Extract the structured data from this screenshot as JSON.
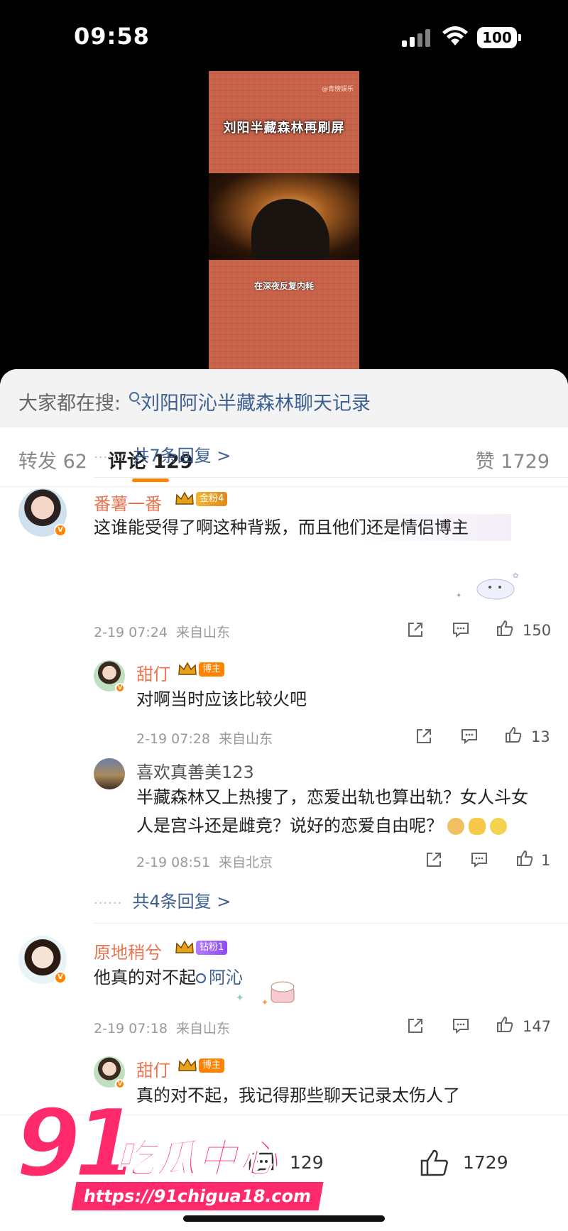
{
  "status_bar": {
    "time": "09:58",
    "battery": "100"
  },
  "video": {
    "title": "刘阳半藏森林再刷屏",
    "caption": "在深夜反复内耗",
    "watermark": "@青榜娱乐"
  },
  "search": {
    "prefix": "大家都在搜:",
    "query": "刘阳阿沁半藏森林聊天记录"
  },
  "tabs": {
    "repost": "转发 62",
    "comment": "评论 129",
    "like": "赞 1729"
  },
  "replies_more_1": "共7条回复 >",
  "comments": [
    {
      "user": "番薯一番",
      "rank": "金粉4",
      "text": "这谁能受得了啊这种背叛，而且他们还是情侣博主",
      "time": "2-19 07:24",
      "location": "来自山东",
      "likes": "150",
      "replies": [
        {
          "user": "甜仃",
          "rank": "博主",
          "text": "对啊当时应该比较火吧",
          "time": "2-19 07:28",
          "location": "来自山东",
          "likes": "13"
        },
        {
          "user": "喜欢真善美123",
          "text_line1": "半藏森林又上热搜了，恋爱出轨也算出轨？女人斗女",
          "text_line2": "人是宫斗还是雌竞？说好的恋爱自由呢？",
          "time": "2-19 08:51",
          "location": "来自北京",
          "likes": "1"
        }
      ],
      "more": "共4条回复 >"
    },
    {
      "user": "原地稍兮",
      "rank": "钻粉1",
      "text": "他真的对不起",
      "search_term": "阿沁",
      "time": "2-19 07:18",
      "location": "来自山东",
      "likes": "147",
      "replies": [
        {
          "user": "甜仃",
          "rank": "博主",
          "text": "真的对不起，我记得那些聊天记录太伤人了"
        }
      ]
    }
  ],
  "bottom_bar": {
    "comment_count": "129",
    "like_count": "1729"
  },
  "watermark_logo": {
    "num": "91",
    "name": "吃瓜中心",
    "url": "https://91chigua18.com"
  },
  "colors": {
    "accent": "#ff8200",
    "username": "#eb7350",
    "link": "#3d5f92",
    "logo": "#ff2a6b"
  }
}
